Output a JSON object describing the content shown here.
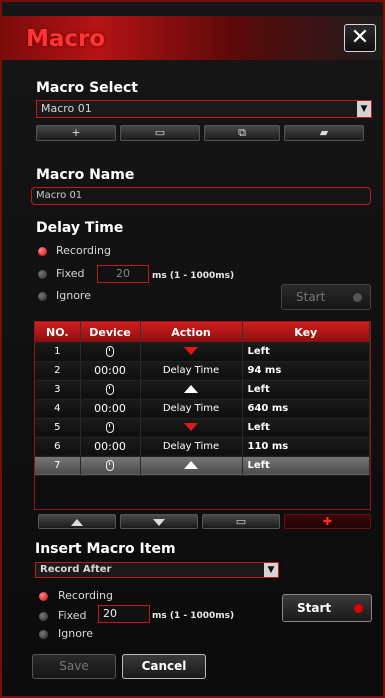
{
  "window": {
    "title": "Macro",
    "close_label": "✕"
  },
  "macro_select": {
    "heading": "Macro Select",
    "selected": "Macro 01",
    "toolbar": [
      {
        "icon": "plus-icon",
        "glyph": "+"
      },
      {
        "icon": "trash-icon",
        "glyph": "🗑"
      },
      {
        "icon": "import-icon",
        "glyph": "⧉"
      },
      {
        "icon": "folder-icon",
        "glyph": "▰"
      }
    ]
  },
  "macro_name": {
    "heading": "Macro Name",
    "value": "Macro 01"
  },
  "delay_time": {
    "heading": "Delay Time",
    "options": [
      "Recording",
      "Fixed",
      "Ignore"
    ],
    "selected": "Recording",
    "fixed_value": "20",
    "range_text": "ms (1 - 1000ms)",
    "start_label": "Start"
  },
  "grid": {
    "columns": [
      "NO.",
      "Device",
      "Action",
      "Key"
    ],
    "rows": [
      {
        "no": "1",
        "device": "mouse",
        "device_text": "",
        "action": "down",
        "action_text": "",
        "key": "Left"
      },
      {
        "no": "2",
        "device": "time",
        "device_text": "00:00",
        "action": "delay",
        "action_text": "Delay Time",
        "key": "94 ms"
      },
      {
        "no": "3",
        "device": "mouse",
        "device_text": "",
        "action": "up",
        "action_text": "",
        "key": "Left"
      },
      {
        "no": "4",
        "device": "time",
        "device_text": "00:00",
        "action": "delay",
        "action_text": "Delay Time",
        "key": "640 ms"
      },
      {
        "no": "5",
        "device": "mouse",
        "device_text": "",
        "action": "down",
        "action_text": "",
        "key": "Left"
      },
      {
        "no": "6",
        "device": "time",
        "device_text": "00:00",
        "action": "delay",
        "action_text": "Delay Time",
        "key": "110 ms"
      },
      {
        "no": "7",
        "device": "mouse",
        "device_text": "",
        "action": "up",
        "action_text": "",
        "key": "Left"
      }
    ],
    "selected_row": "7",
    "buttons": [
      "move-up-icon",
      "move-down-icon",
      "trash-icon",
      "insert-icon"
    ]
  },
  "insert_item": {
    "heading": "Insert Macro Item",
    "mode": "Record After",
    "options": [
      "Recording",
      "Fixed",
      "Ignore"
    ],
    "selected": "Recording",
    "fixed_value": "20",
    "range_text": "ms (1 - 1000ms)",
    "start_label": "Start"
  },
  "footer": {
    "save_label": "Save",
    "cancel_label": "Cancel"
  },
  "colors": {
    "accent": "#c11818",
    "title": "#ff3434",
    "record_dot": "#e00000"
  }
}
